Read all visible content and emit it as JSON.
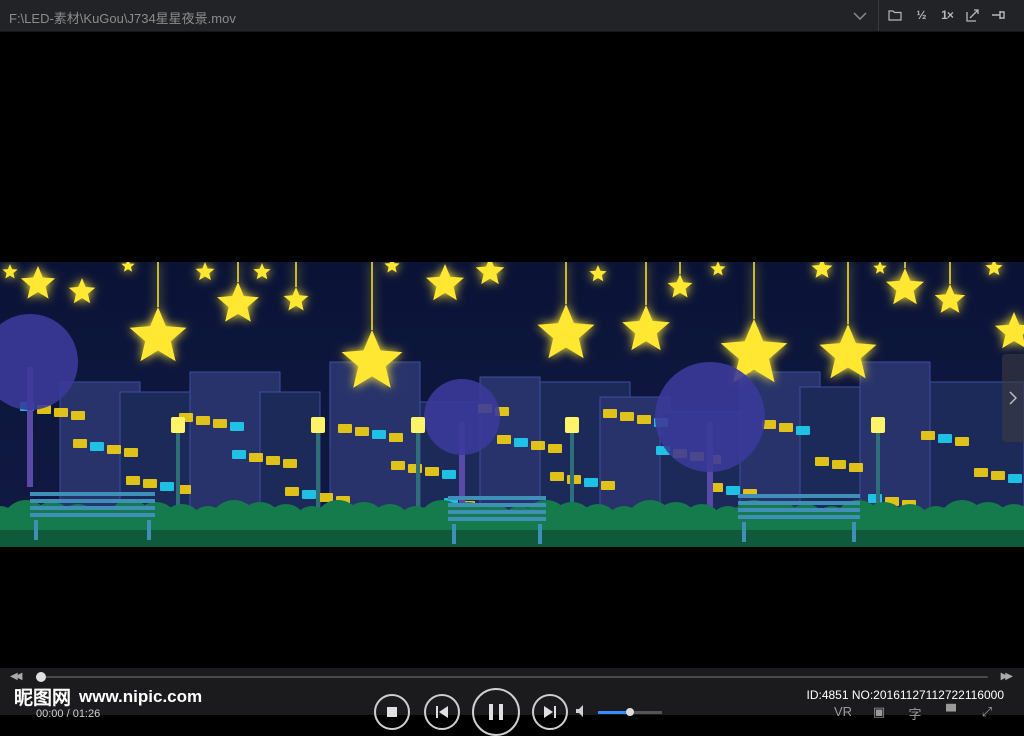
{
  "window": {
    "title": "F:\\LED-素材\\KuGou\\J734星星夜景.mov"
  },
  "toolbar": {
    "items": [
      {
        "icon": "folder-icon"
      },
      {
        "icon": "half-speed-icon",
        "label": "½"
      },
      {
        "icon": "one-times-icon",
        "label": "1×"
      },
      {
        "icon": "screenshot-icon"
      },
      {
        "icon": "pin-icon"
      }
    ]
  },
  "player": {
    "time_display": "00:00 / 01:26",
    "progress_fraction": 0.005,
    "volume_fraction": 0.5,
    "right_controls": [
      "VR",
      "▣",
      "字",
      "▝▘",
      "⤢"
    ]
  },
  "watermark": {
    "logo_text": "昵图网",
    "url": "www.nipic.com",
    "id_text": "ID:4851 NO:20161127112722116000"
  },
  "colors": {
    "background": "#000000",
    "titlebar": "#222326",
    "controls": "#1b1b1d",
    "accent": "#3a8bff",
    "star": "#ffe733",
    "sky": "#0a1230"
  }
}
